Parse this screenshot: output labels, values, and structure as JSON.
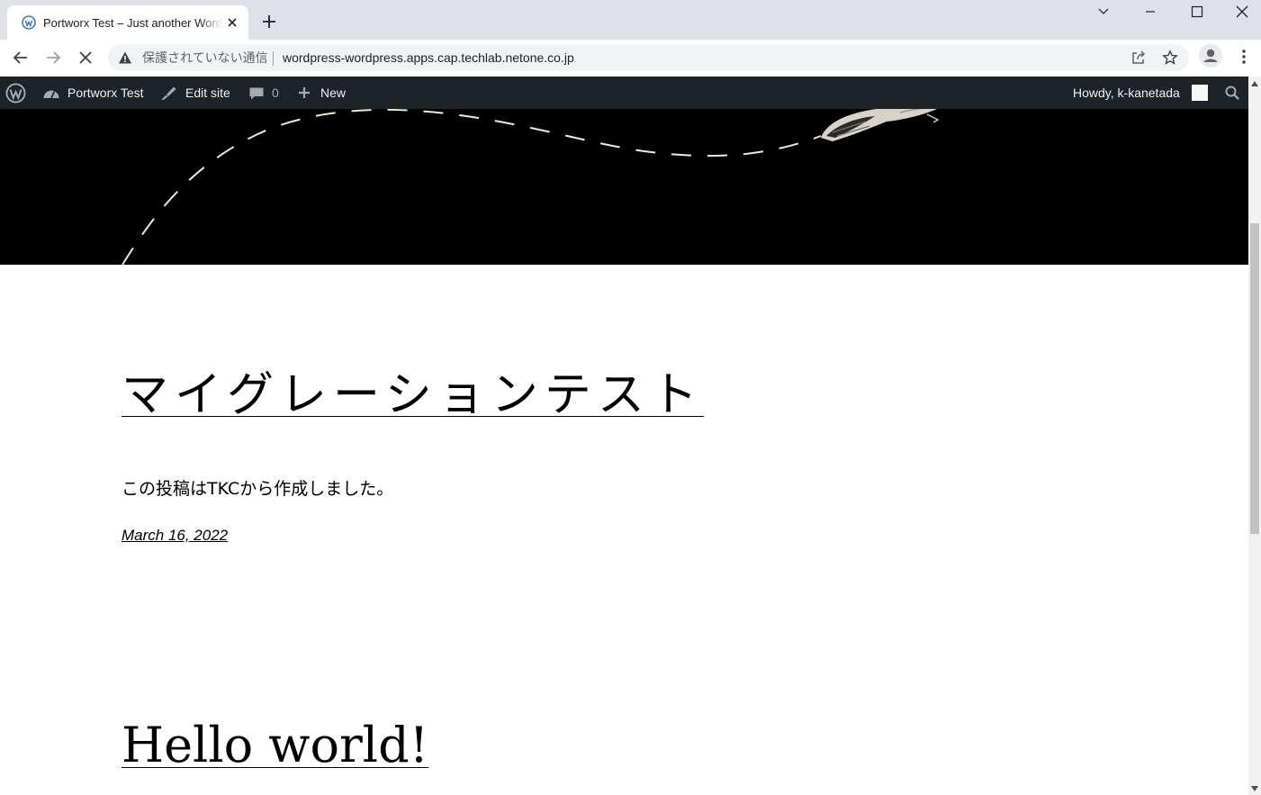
{
  "browser": {
    "tab": {
      "title": "Portworx Test – Just another WordPress site",
      "favicon": "wordpress-icon"
    },
    "address_bar": {
      "security_label": "保護されていない通信",
      "url": "wordpress-wordpress.apps.cap.techlab.netone.co.jp"
    },
    "icons": [
      "back-icon",
      "forward-icon",
      "stop-icon",
      "warning-icon",
      "share-icon",
      "star-icon",
      "profile-icon",
      "menu-icon",
      "new-tab-icon",
      "tab-search-icon",
      "minimize-icon",
      "maximize-icon",
      "close-icon"
    ]
  },
  "admin_bar": {
    "site_name": "Portworx Test",
    "edit_site": "Edit site",
    "comments_count": "0",
    "new_label": "New",
    "howdy": "Howdy, k-kanetada"
  },
  "posts": [
    {
      "title": "マイグレーションテスト",
      "excerpt": "この投稿はTKCから作成しました。",
      "date": "March 16, 2022"
    },
    {
      "title": "Hello world!"
    }
  ],
  "colors": {
    "admin_bar_bg": "#1d2327",
    "tabstrip_bg": "#dee1e6",
    "hero_bg": "#000000",
    "hero_dash": "#f3e6d2"
  }
}
